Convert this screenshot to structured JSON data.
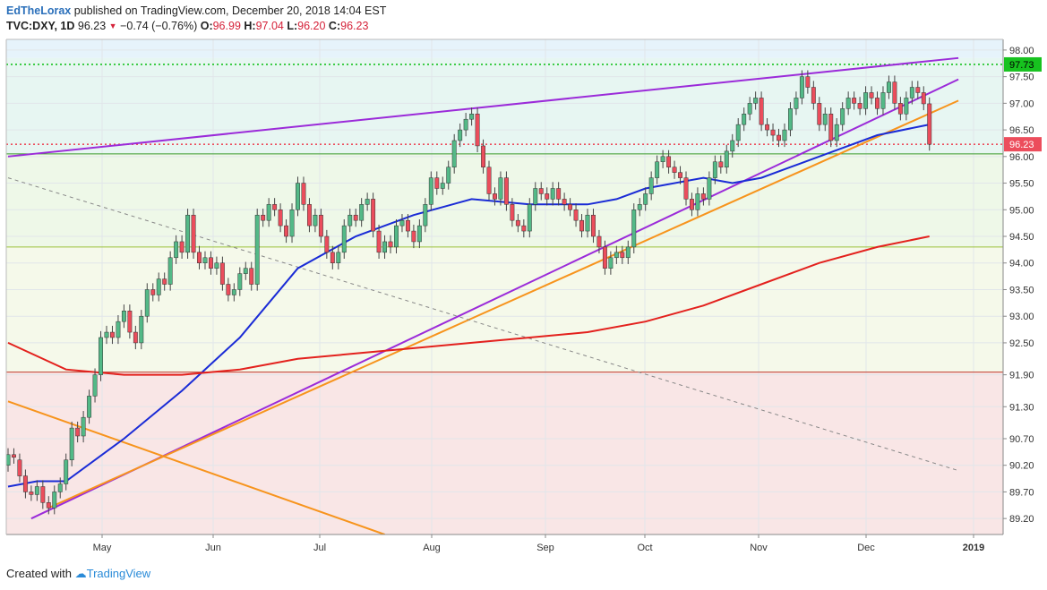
{
  "header": {
    "author": "EdTheLorax",
    "published": "published on TradingView.com, December 20, 2018 14:04 EST",
    "symbol": "TVC:DXY, 1D",
    "last": "96.23",
    "change": "−0.74 (−0.76%)",
    "o_label": "O:",
    "o_value": "96.99",
    "h_label": "H:",
    "h_value": "97.04",
    "l_label": "L:",
    "l_value": "96.20",
    "c_label": "C:",
    "c_value": "96.23"
  },
  "footer": {
    "prefix": "Created with",
    "brand": "TradingView"
  },
  "colors": {
    "up_candle": "#53b987",
    "down_candle": "#eb4d5c",
    "wick": "#444444",
    "ma_blue": "#1a2bd6",
    "ma_red": "#e3211d",
    "purple": "#9b2bd9",
    "orange": "#f7941d",
    "current_price_label": "#ec4d5c",
    "green_label": "#17c21f"
  },
  "chart_data": {
    "type": "candlestick",
    "symbol": "TVC:DXY",
    "interval": "1D",
    "ylim": [
      88.9,
      98.2
    ],
    "y_ticks": [
      98.0,
      97.5,
      97.0,
      96.5,
      96.0,
      95.5,
      95.0,
      94.5,
      94.0,
      93.5,
      93.0,
      92.5,
      91.9,
      91.3,
      90.7,
      90.2,
      89.7,
      89.2
    ],
    "x_ticks": [
      "May",
      "Jun",
      "Jul",
      "Aug",
      "Sep",
      "Oct",
      "Nov",
      "Dec",
      "2019"
    ],
    "price_labels": [
      {
        "value": 97.73,
        "kind": "level"
      },
      {
        "value": 96.23,
        "kind": "last"
      }
    ],
    "candles": [
      [
        90.2,
        90.4
      ],
      [
        90.4,
        90.35
      ],
      [
        90.3,
        90.0
      ],
      [
        90.0,
        89.7
      ],
      [
        89.7,
        89.65
      ],
      [
        89.65,
        89.8
      ],
      [
        89.8,
        89.5
      ],
      [
        89.5,
        89.4
      ],
      [
        89.4,
        89.7
      ],
      [
        89.7,
        89.85
      ],
      [
        89.85,
        90.3
      ],
      [
        90.3,
        90.9
      ],
      [
        90.9,
        90.75
      ],
      [
        90.75,
        91.1
      ],
      [
        91.1,
        91.5
      ],
      [
        91.5,
        91.9
      ],
      [
        91.9,
        92.6
      ],
      [
        92.6,
        92.7
      ],
      [
        92.7,
        92.6
      ],
      [
        92.6,
        92.9
      ],
      [
        92.9,
        93.1
      ],
      [
        93.1,
        92.7
      ],
      [
        92.7,
        92.5
      ],
      [
        92.5,
        93.0
      ],
      [
        93.0,
        93.5
      ],
      [
        93.5,
        93.4
      ],
      [
        93.4,
        93.7
      ],
      [
        93.7,
        93.6
      ],
      [
        93.6,
        94.1
      ],
      [
        94.1,
        94.4
      ],
      [
        94.4,
        94.2
      ],
      [
        94.2,
        94.9
      ],
      [
        94.9,
        94.2
      ],
      [
        94.2,
        94.0
      ],
      [
        94.0,
        94.1
      ],
      [
        94.1,
        93.9
      ],
      [
        93.9,
        94.0
      ],
      [
        94.0,
        93.6
      ],
      [
        93.6,
        93.4
      ],
      [
        93.4,
        93.5
      ],
      [
        93.5,
        93.8
      ],
      [
        93.8,
        93.9
      ],
      [
        93.9,
        93.6
      ],
      [
        93.6,
        94.9
      ],
      [
        94.9,
        94.8
      ],
      [
        94.8,
        95.1
      ],
      [
        95.1,
        95.0
      ],
      [
        95.0,
        94.7
      ],
      [
        94.7,
        94.5
      ],
      [
        94.5,
        95.0
      ],
      [
        95.0,
        95.5
      ],
      [
        95.5,
        95.1
      ],
      [
        95.1,
        94.7
      ],
      [
        94.7,
        94.9
      ],
      [
        94.9,
        94.5
      ],
      [
        94.5,
        94.2
      ],
      [
        94.2,
        94.0
      ],
      [
        94.0,
        94.2
      ],
      [
        94.2,
        94.7
      ],
      [
        94.7,
        94.9
      ],
      [
        94.9,
        94.8
      ],
      [
        94.8,
        95.1
      ],
      [
        95.1,
        95.2
      ],
      [
        95.2,
        94.6
      ],
      [
        94.6,
        94.2
      ],
      [
        94.2,
        94.4
      ],
      [
        94.4,
        94.3
      ],
      [
        94.3,
        94.7
      ],
      [
        94.7,
        94.8
      ],
      [
        94.8,
        94.6
      ],
      [
        94.6,
        94.4
      ],
      [
        94.4,
        94.7
      ],
      [
        94.7,
        95.1
      ],
      [
        95.1,
        95.6
      ],
      [
        95.6,
        95.4
      ],
      [
        95.4,
        95.5
      ],
      [
        95.5,
        95.8
      ],
      [
        95.8,
        96.3
      ],
      [
        96.3,
        96.5
      ],
      [
        96.5,
        96.7
      ],
      [
        96.7,
        96.8
      ],
      [
        96.8,
        96.2
      ],
      [
        96.2,
        95.8
      ],
      [
        95.8,
        95.3
      ],
      [
        95.3,
        95.2
      ],
      [
        95.2,
        95.6
      ],
      [
        95.6,
        95.1
      ],
      [
        95.1,
        94.8
      ],
      [
        94.8,
        94.7
      ],
      [
        94.7,
        94.6
      ],
      [
        94.6,
        95.1
      ],
      [
        95.1,
        95.4
      ],
      [
        95.4,
        95.3
      ],
      [
        95.3,
        95.2
      ],
      [
        95.2,
        95.4
      ],
      [
        95.4,
        95.2
      ],
      [
        95.2,
        95.1
      ],
      [
        95.1,
        95.0
      ],
      [
        95.0,
        94.8
      ],
      [
        94.8,
        94.6
      ],
      [
        94.6,
        94.9
      ],
      [
        94.9,
        94.5
      ],
      [
        94.5,
        94.3
      ],
      [
        94.3,
        93.9
      ],
      [
        93.9,
        94.1
      ],
      [
        94.1,
        94.2
      ],
      [
        94.2,
        94.1
      ],
      [
        94.1,
        94.3
      ],
      [
        94.3,
        95.0
      ],
      [
        95.0,
        95.1
      ],
      [
        95.1,
        95.3
      ],
      [
        95.3,
        95.6
      ],
      [
        95.6,
        95.9
      ],
      [
        95.9,
        96.0
      ],
      [
        96.0,
        95.8
      ],
      [
        95.8,
        95.7
      ],
      [
        95.7,
        95.6
      ],
      [
        95.6,
        95.2
      ],
      [
        95.2,
        95.0
      ],
      [
        95.0,
        95.3
      ],
      [
        95.3,
        95.2
      ],
      [
        95.2,
        95.6
      ],
      [
        95.6,
        95.9
      ],
      [
        95.9,
        95.8
      ],
      [
        95.8,
        96.1
      ],
      [
        96.1,
        96.3
      ],
      [
        96.3,
        96.6
      ],
      [
        96.6,
        96.8
      ],
      [
        96.8,
        97.0
      ],
      [
        97.0,
        97.1
      ],
      [
        97.1,
        96.6
      ],
      [
        96.6,
        96.5
      ],
      [
        96.5,
        96.4
      ],
      [
        96.4,
        96.3
      ],
      [
        96.3,
        96.5
      ],
      [
        96.5,
        96.9
      ],
      [
        96.9,
        97.1
      ],
      [
        97.1,
        97.5
      ],
      [
        97.5,
        97.3
      ],
      [
        97.3,
        97.0
      ],
      [
        97.0,
        96.6
      ],
      [
        96.6,
        96.8
      ],
      [
        96.8,
        96.3
      ],
      [
        96.3,
        96.6
      ],
      [
        96.6,
        96.9
      ],
      [
        96.9,
        97.1
      ],
      [
        97.1,
        97.0
      ],
      [
        97.0,
        96.9
      ],
      [
        96.9,
        97.2
      ],
      [
        97.2,
        97.1
      ],
      [
        97.1,
        96.9
      ],
      [
        96.9,
        97.2
      ],
      [
        97.2,
        97.4
      ],
      [
        97.4,
        97.0
      ],
      [
        97.0,
        96.8
      ],
      [
        96.8,
        97.1
      ],
      [
        97.1,
        97.3
      ],
      [
        97.3,
        97.2
      ],
      [
        97.2,
        96.99
      ],
      [
        96.99,
        96.23
      ]
    ],
    "series": [
      {
        "name": "",
        "kind": "moving-average",
        "color": "#1a2bd6",
        "x": [
          0,
          5,
          10,
          20,
          30,
          40,
          50,
          60,
          70,
          80,
          90,
          100,
          105,
          110,
          120,
          125,
          130,
          135,
          140,
          145,
          150,
          159
        ],
        "y": [
          89.8,
          89.9,
          89.9,
          90.7,
          91.6,
          92.6,
          93.9,
          94.5,
          94.9,
          95.2,
          95.1,
          95.1,
          95.2,
          95.4,
          95.6,
          95.5,
          95.6,
          95.8,
          96.0,
          96.2,
          96.4,
          96.6
        ]
      },
      {
        "name": "",
        "kind": "moving-average",
        "color": "#e3211d",
        "x": [
          0,
          10,
          20,
          30,
          40,
          50,
          60,
          70,
          80,
          90,
          100,
          110,
          120,
          130,
          140,
          150,
          159
        ],
        "y": [
          92.5,
          92.0,
          91.9,
          91.9,
          92.0,
          92.2,
          92.3,
          92.4,
          92.5,
          92.6,
          92.7,
          92.9,
          93.2,
          93.6,
          94.0,
          94.3,
          94.5
        ]
      }
    ],
    "trendlines": [
      {
        "color": "#9b2bd9",
        "style": "solid",
        "from": [
          0,
          96.0
        ],
        "to": [
          164,
          97.85
        ]
      },
      {
        "color": "#9b2bd9",
        "style": "solid",
        "from": [
          4,
          89.2
        ],
        "to": [
          164,
          97.45
        ]
      },
      {
        "color": "#f7941d",
        "style": "solid",
        "from": [
          7,
          89.4
        ],
        "to": [
          164,
          97.05
        ]
      },
      {
        "color": "#f7941d",
        "style": "solid",
        "from": [
          0,
          91.4
        ],
        "to": [
          65,
          88.9
        ]
      },
      {
        "color": "#888888",
        "style": "dashed",
        "from": [
          0,
          95.6
        ],
        "to": [
          164,
          90.1
        ]
      }
    ],
    "horizontal_levels": [
      {
        "value": 97.73,
        "color": "#17c21f",
        "style": "dotted"
      },
      {
        "value": 96.05,
        "color": "#3a9a2a",
        "style": "solid"
      },
      {
        "value": 94.3,
        "color": "#9bc23a",
        "style": "solid"
      },
      {
        "value": 91.95,
        "color": "#c0392b",
        "style": "solid"
      },
      {
        "value": 96.23,
        "color": "#ec4d5c",
        "style": "dotted"
      }
    ],
    "zones": [
      {
        "from": 97.85,
        "to": 98.2,
        "color": "#e6f3fb"
      },
      {
        "from": 96.05,
        "to": 97.85,
        "color": "#e7f6f2"
      },
      {
        "from": 94.3,
        "to": 96.05,
        "color": "#eef8e8"
      },
      {
        "from": 91.95,
        "to": 94.3,
        "color": "#f5f9ea"
      },
      {
        "from": 88.9,
        "to": 91.95,
        "color": "#f9e6e6"
      }
    ]
  }
}
